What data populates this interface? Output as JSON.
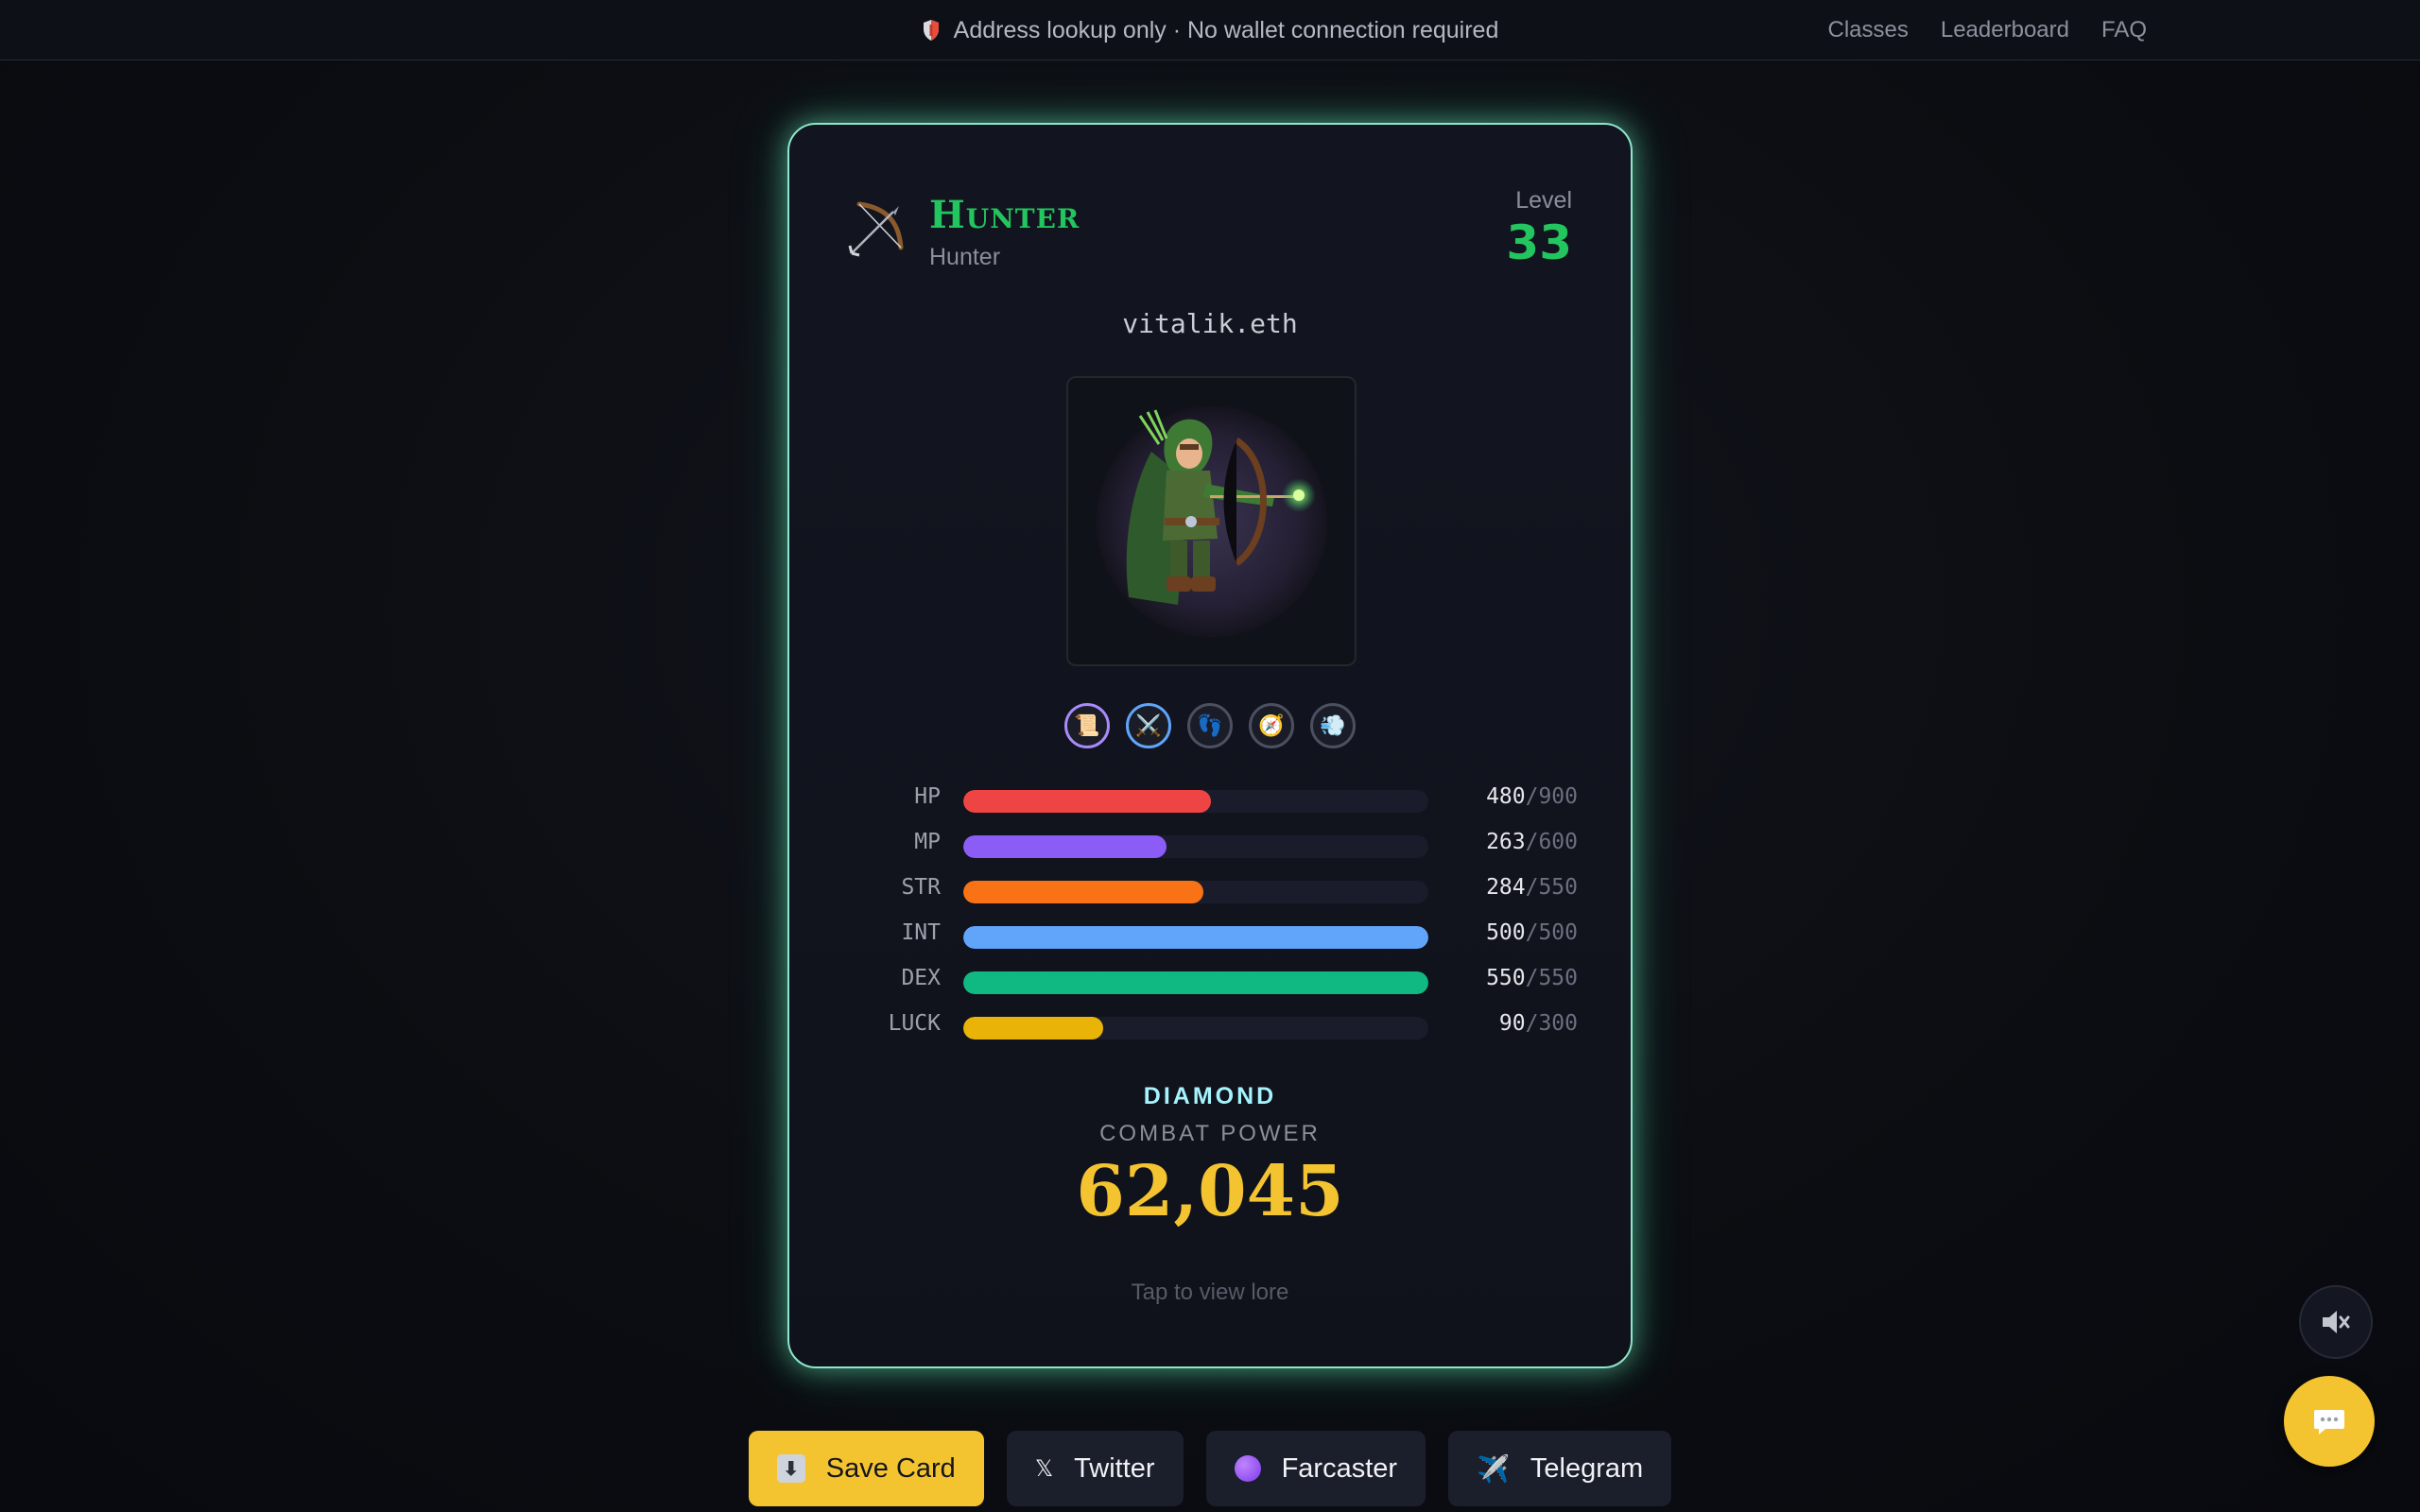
{
  "topbar": {
    "notice": "Address lookup only · No wallet connection required",
    "nav": [
      "Classes",
      "Leaderboard",
      "FAQ"
    ]
  },
  "card": {
    "class_icon": "bow-and-arrow-icon",
    "class_name": "Hunter",
    "class_subtitle": "Hunter",
    "level_label": "Level",
    "level_value": "33",
    "address": "vitalik.eth",
    "portrait": "hooded-archer-character",
    "badges": [
      {
        "icon": "scroll-icon",
        "accent": "#a78bfa"
      },
      {
        "icon": "crossed-swords-icon",
        "accent": "#60a5fa"
      },
      {
        "icon": "footprints-icon",
        "accent": "#4b5060"
      },
      {
        "icon": "compass-icon",
        "accent": "#4b5060"
      },
      {
        "icon": "dash-cloud-icon",
        "accent": "#4b5060"
      }
    ],
    "stats": [
      {
        "label": "HP",
        "value": "480",
        "max": "/900",
        "color": "#ef4444",
        "fraction": 0.533
      },
      {
        "label": "MP",
        "value": "263",
        "max": "/600",
        "color": "#8b5cf6",
        "fraction": 0.438
      },
      {
        "label": "STR",
        "value": "284",
        "max": "/550",
        "color": "#f97316",
        "fraction": 0.516
      },
      {
        "label": "INT",
        "value": "500",
        "max": "/500",
        "color": "#60a5fa",
        "fraction": 1.0
      },
      {
        "label": "DEX",
        "value": "550",
        "max": "/550",
        "color": "#10b981",
        "fraction": 1.0
      },
      {
        "label": "LUCK",
        "value": "90",
        "max": "/300",
        "color": "#eab308",
        "fraction": 0.3
      }
    ],
    "tier": "DIAMOND",
    "combat_power_label": "COMBAT POWER",
    "combat_power": "62,045",
    "lore_hint": "Tap to view lore"
  },
  "actions": {
    "save": "Save Card",
    "twitter": "Twitter",
    "farcaster": "Farcaster",
    "telegram": "Telegram"
  },
  "colors": {
    "accent_gold": "#f4c430",
    "accent_green": "#22c55e",
    "card_glow": "#8ee6cc"
  }
}
